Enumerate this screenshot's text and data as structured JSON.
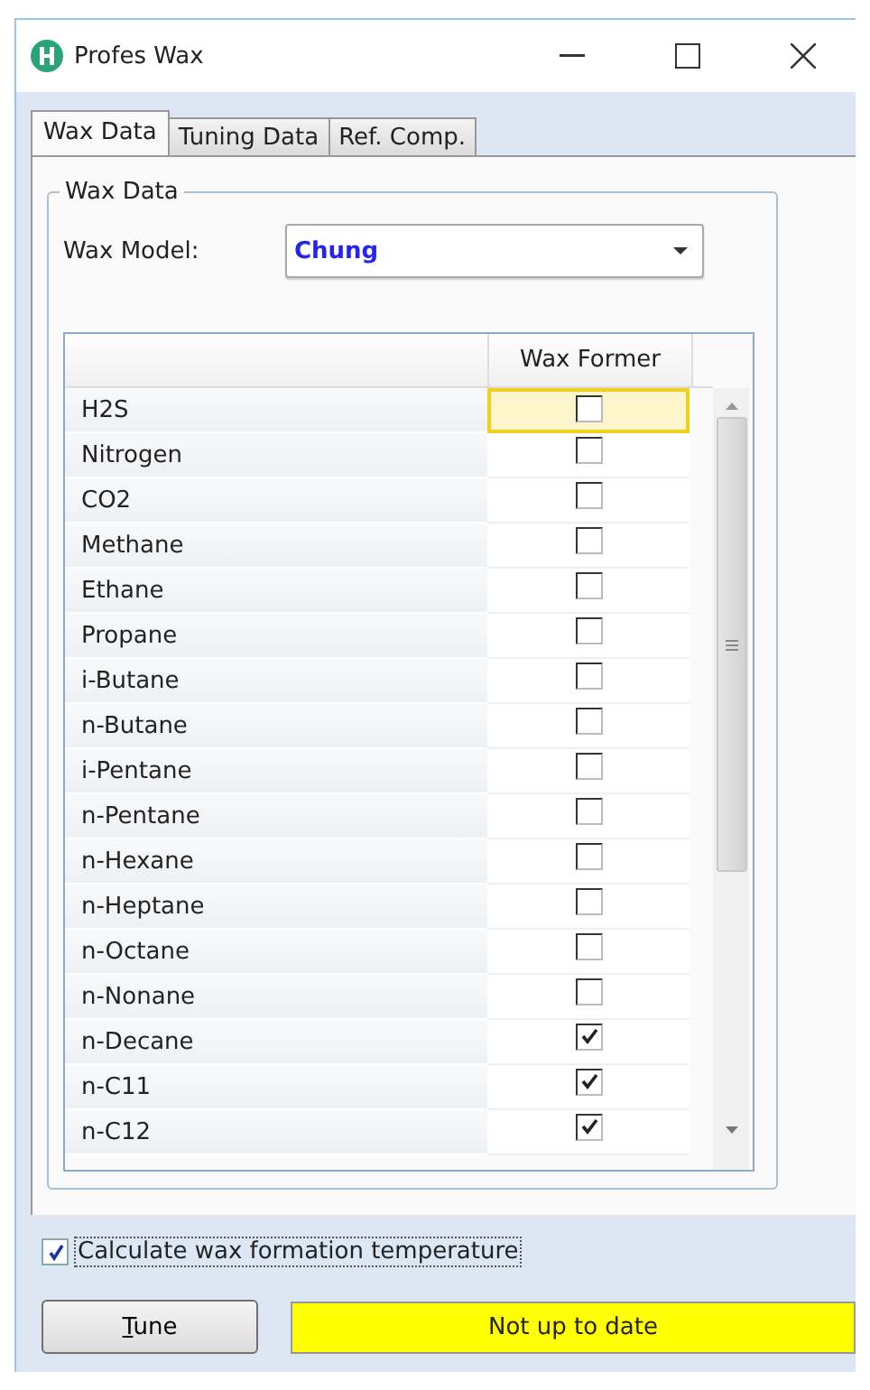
{
  "window": {
    "title": "Profes Wax"
  },
  "tabs": [
    {
      "label": "Wax Data",
      "selected": true
    },
    {
      "label": "Tuning Data",
      "selected": false
    },
    {
      "label": "Ref. Comp.",
      "selected": false
    }
  ],
  "group": {
    "title": "Wax Data",
    "model_label": "Wax Model:",
    "model_value": "Chung"
  },
  "table": {
    "columns": [
      "Wax Former"
    ],
    "rows": [
      {
        "name": "H2S",
        "checked": false,
        "selected": true
      },
      {
        "name": "Nitrogen",
        "checked": false,
        "selected": false
      },
      {
        "name": "CO2",
        "checked": false,
        "selected": false
      },
      {
        "name": "Methane",
        "checked": false,
        "selected": false
      },
      {
        "name": "Ethane",
        "checked": false,
        "selected": false
      },
      {
        "name": "Propane",
        "checked": false,
        "selected": false
      },
      {
        "name": "i-Butane",
        "checked": false,
        "selected": false
      },
      {
        "name": "n-Butane",
        "checked": false,
        "selected": false
      },
      {
        "name": "i-Pentane",
        "checked": false,
        "selected": false
      },
      {
        "name": "n-Pentane",
        "checked": false,
        "selected": false
      },
      {
        "name": "n-Hexane",
        "checked": false,
        "selected": false
      },
      {
        "name": "n-Heptane",
        "checked": false,
        "selected": false
      },
      {
        "name": "n-Octane",
        "checked": false,
        "selected": false
      },
      {
        "name": "n-Nonane",
        "checked": false,
        "selected": false
      },
      {
        "name": "n-Decane",
        "checked": true,
        "selected": false
      },
      {
        "name": "n-C11",
        "checked": true,
        "selected": false
      },
      {
        "name": "n-C12",
        "checked": true,
        "selected": false
      }
    ]
  },
  "calculate": {
    "label": "Calculate wax formation temperature",
    "checked": true,
    "focused": true
  },
  "tune_button": {
    "label": "Tune"
  },
  "status": {
    "text": "Not up to date",
    "kind": "warning"
  }
}
